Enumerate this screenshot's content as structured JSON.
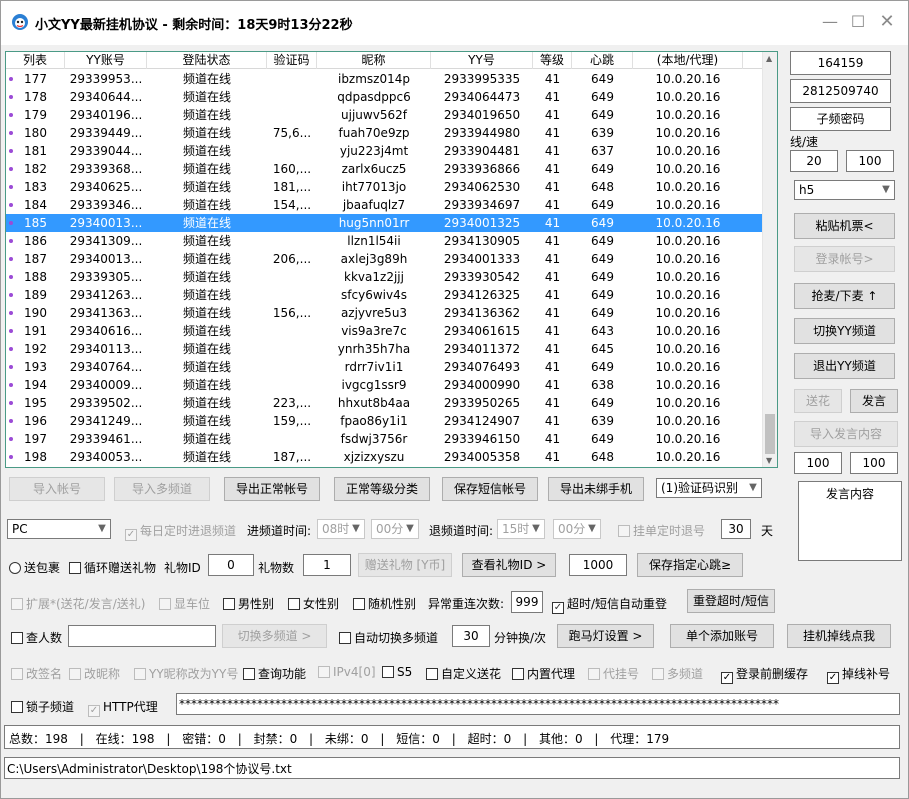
{
  "title": "小文YY最新挂机协议 - 剩余时间：18天9时13分22秒",
  "columns": [
    "列表",
    "YY账号",
    "登陆状态",
    "验证码",
    "昵称",
    "YY号",
    "等级",
    "心跳",
    "(本地/代理)"
  ],
  "rows": [
    [
      "177",
      "29339953...",
      "频道在线",
      "",
      "ibzmsz014p",
      "2933995335",
      "41",
      "649",
      "10.0.20.16"
    ],
    [
      "178",
      "29340644...",
      "频道在线",
      "",
      "qdpasdppc6",
      "2934064473",
      "41",
      "649",
      "10.0.20.16"
    ],
    [
      "179",
      "29340196...",
      "频道在线",
      "",
      "ujjuwv562f",
      "2934019650",
      "41",
      "649",
      "10.0.20.16"
    ],
    [
      "180",
      "29339449...",
      "频道在线",
      "75,6...",
      "fuah70e9zp",
      "2933944980",
      "41",
      "639",
      "10.0.20.16"
    ],
    [
      "181",
      "29339044...",
      "频道在线",
      "",
      "yju223j4mt",
      "2933904481",
      "41",
      "637",
      "10.0.20.16"
    ],
    [
      "182",
      "29339368...",
      "频道在线",
      "160,...",
      "zarlx6ucz5",
      "2933936866",
      "41",
      "649",
      "10.0.20.16"
    ],
    [
      "183",
      "29340625...",
      "频道在线",
      "181,...",
      "iht77013jo",
      "2934062530",
      "41",
      "648",
      "10.0.20.16"
    ],
    [
      "184",
      "29339346...",
      "频道在线",
      "154,...",
      "jbaafuqlz7",
      "2933934697",
      "41",
      "649",
      "10.0.20.16"
    ],
    [
      "185",
      "29340013...",
      "频道在线",
      "",
      "hug5nn01rr",
      "2934001325",
      "41",
      "649",
      "10.0.20.16"
    ],
    [
      "186",
      "29341309...",
      "频道在线",
      "",
      "llzn1l54ii",
      "2934130905",
      "41",
      "649",
      "10.0.20.16"
    ],
    [
      "187",
      "29340013...",
      "频道在线",
      "206,...",
      "axlej3g89h",
      "2934001333",
      "41",
      "649",
      "10.0.20.16"
    ],
    [
      "188",
      "29339305...",
      "频道在线",
      "",
      "kkva1z2jjj",
      "2933930542",
      "41",
      "649",
      "10.0.20.16"
    ],
    [
      "189",
      "29341263...",
      "频道在线",
      "",
      "sfcy6wiv4s",
      "2934126325",
      "41",
      "649",
      "10.0.20.16"
    ],
    [
      "190",
      "29341363...",
      "频道在线",
      "156,...",
      "azjyvre5u3",
      "2934136362",
      "41",
      "649",
      "10.0.20.16"
    ],
    [
      "191",
      "29340616...",
      "频道在线",
      "",
      "vis9a3re7c",
      "2934061615",
      "41",
      "643",
      "10.0.20.16"
    ],
    [
      "192",
      "29340113...",
      "频道在线",
      "",
      "ynrh35h7ha",
      "2934011372",
      "41",
      "645",
      "10.0.20.16"
    ],
    [
      "193",
      "29340764...",
      "频道在线",
      "",
      "rdrr7iv1i1",
      "2934076493",
      "41",
      "649",
      "10.0.20.16"
    ],
    [
      "194",
      "29340009...",
      "频道在线",
      "",
      "ivgcg1ssr9",
      "2934000990",
      "41",
      "638",
      "10.0.20.16"
    ],
    [
      "195",
      "29339502...",
      "频道在线",
      "223,...",
      "hhxut8b4aa",
      "2933950265",
      "41",
      "649",
      "10.0.20.16"
    ],
    [
      "196",
      "29341249...",
      "频道在线",
      "159,...",
      "fpao86y1i1",
      "2934124907",
      "41",
      "639",
      "10.0.20.16"
    ],
    [
      "197",
      "29339461...",
      "频道在线",
      "",
      "fsdwj3756r",
      "2933946150",
      "41",
      "649",
      "10.0.20.16"
    ],
    [
      "198",
      "29340053...",
      "频道在线",
      "187,...",
      "xjzizxyszu",
      "2934005358",
      "41",
      "648",
      "10.0.20.16"
    ]
  ],
  "selected_row": "185",
  "right": {
    "field1": "164159",
    "field2": "2812509740",
    "subchannel_pwd": "子频密码",
    "speed_label": "线/速",
    "speed_a": "20",
    "speed_b": "100",
    "combo": "h5",
    "paste": "粘贴机票<",
    "login": "登录帐号>",
    "grab": "抢麦/下麦 ↑",
    "switch": "切换YY频道",
    "exit": "退出YY频道",
    "gift": "送花",
    "speak": "发言",
    "import_speak": "导入发言内容",
    "num_a": "100",
    "num_b": "100",
    "speak_content": "发言内容"
  },
  "row1": {
    "import_acc": "导入帐号",
    "import_multi": "导入多频道",
    "export_normal": "导出正常帐号",
    "level_sort": "正常等级分类",
    "save_sms": "保存短信帐号",
    "export_unbound": "导出未绑手机",
    "captcha": "(1)验证码识别"
  },
  "row2": {
    "platform": "PC",
    "daily": "每日定时进退频道",
    "enter_label": "进频道时间:",
    "enter_h": "08时",
    "enter_m": "00分",
    "exit_label": "退频道时间:",
    "exit_h": "15时",
    "exit_m": "00分",
    "hang_single": "挂单定时退号",
    "days": "30",
    "days_unit": "天"
  },
  "row3": {
    "send_pkg": "送包裹",
    "loop_gift": "循环赠送礼物",
    "gift_id_label": "礼物ID",
    "gift_id": "0",
    "gift_num_label": "礼物数",
    "gift_num": "1",
    "give_gift": "赠送礼物 [Y币]",
    "view_gift": "查看礼物ID >",
    "heart_val": "1000",
    "save_heart": "保存指定心跳≥"
  },
  "row4": {
    "expand": "扩展*(送花/发言/送礼)",
    "show_seat": "显车位",
    "male": "男性别",
    "female": "女性别",
    "random": "随机性别",
    "retry_label": "异常重连次数:",
    "retry": "999",
    "auto_retry": "超时/短信自动重登",
    "relogin": "重登超时/短信"
  },
  "row5": {
    "check_count": "查人数",
    "switch_multi": "切换多频道 >",
    "auto_switch": "自动切换多频道",
    "minutes": "30",
    "minutes_label": "分钟换/次",
    "marquee": "跑马灯设置 >",
    "add_single": "单个添加账号",
    "hang_drop": "挂机掉线点我"
  },
  "row6": {
    "rename": "改签名",
    "renick": "改昵称",
    "yy_nick": "YY昵称改为YY号",
    "query": "查询功能",
    "ipv4": "IPv4[0]",
    "s5": "S5",
    "custom_flower": "自定义送花",
    "builtin_proxy": "内置代理",
    "proxy_hang": "代挂号",
    "multi_channel": "多频道",
    "cache": "登录前删缓存",
    "drop_fill": "掉线补号"
  },
  "row7": {
    "lock_channel": "锁子频道",
    "http_proxy": "HTTP代理",
    "proxy_text": "****************************************************************************************************"
  },
  "status": {
    "total": "总数：198",
    "online": "在线：198",
    "pwd_err": "密错：0",
    "banned": "封禁：0",
    "unbound": "未绑：0",
    "sms": "短信：0",
    "timeout": "超时：0",
    "other": "其他：0",
    "proxy": "代理：179",
    "sep": "|"
  },
  "path": "C:\\Users\\Administrator\\Desktop\\198个协议号.txt"
}
